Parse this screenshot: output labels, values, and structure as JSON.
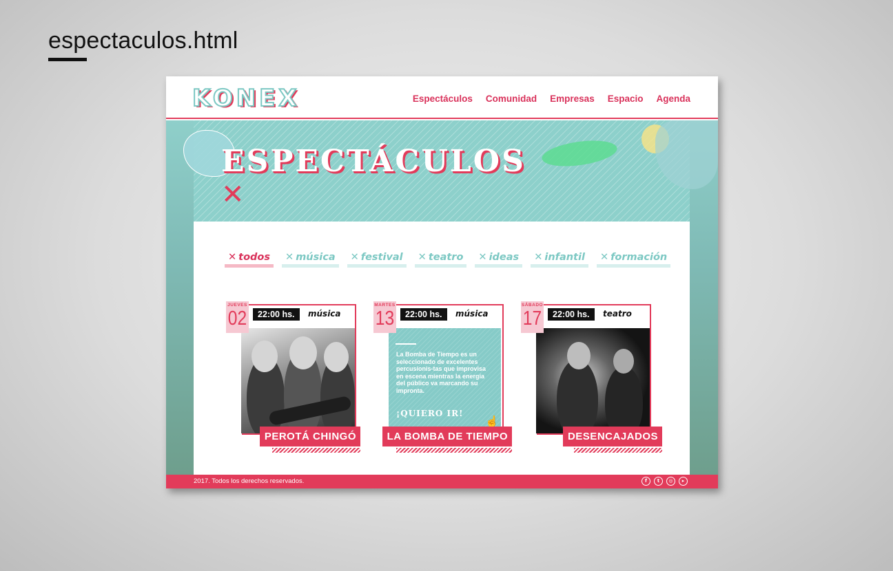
{
  "page_heading": "espectaculos.html",
  "site": {
    "logo": "KONEX",
    "nav": [
      "Espectáculos",
      "Comunidad",
      "Empresas",
      "Espacio",
      "Agenda"
    ],
    "hero_title": "ESPECTÁCULOS",
    "hero_mark": "✕",
    "filters": [
      {
        "label": "todos",
        "active": true
      },
      {
        "label": "música",
        "active": false
      },
      {
        "label": "festival",
        "active": false
      },
      {
        "label": "teatro",
        "active": false
      },
      {
        "label": "ideas",
        "active": false
      },
      {
        "label": "infantil",
        "active": false
      },
      {
        "label": "formación",
        "active": false
      }
    ],
    "filter_mark": "✕",
    "events": [
      {
        "day": "JUEVES",
        "date": "02",
        "time": "22:00 hs.",
        "genre": "música",
        "title": "PEROTÁ CHINGÓ"
      },
      {
        "day": "MARTES",
        "date": "13",
        "time": "22:00 hs.",
        "genre": "música",
        "title": "LA BOMBA DE TIEMPO",
        "description": "La Bomba de Tiempo es un seleccionado de excelentes percusionis-tas que improvisa en escena mientras la energía del público va marcando su impronta.",
        "cta": "¡QUIERO IR!"
      },
      {
        "day": "SÁBADO",
        "date": "17",
        "time": "22:00 hs.",
        "genre": "teatro",
        "title": "DESENCAJADOS"
      }
    ],
    "footer": "2017. Todos los derechos reservados.",
    "social": [
      "facebook-icon",
      "twitter-icon",
      "instagram-icon",
      "youtube-icon"
    ],
    "colors": {
      "accent": "#e23b5a",
      "teal": "#7cc8c3"
    }
  }
}
